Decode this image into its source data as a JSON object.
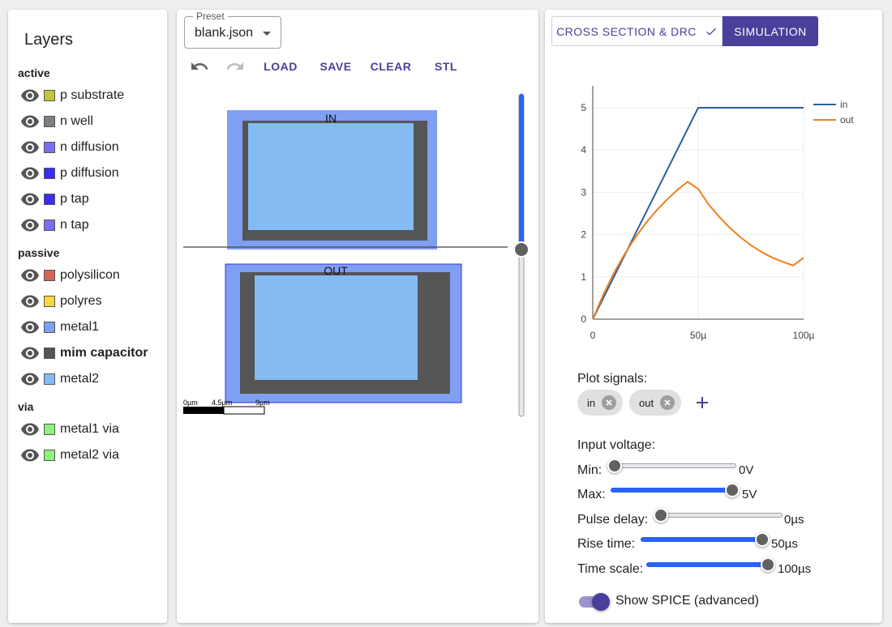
{
  "layers": {
    "title": "Layers",
    "groups": [
      {
        "name": "active",
        "items": [
          {
            "label": "p substrate",
            "color": "#c2c43a"
          },
          {
            "label": "n well",
            "color": "#7f7f7f"
          },
          {
            "label": "n diffusion",
            "color": "#7b6ef2"
          },
          {
            "label": "p diffusion",
            "color": "#3a2cf2"
          },
          {
            "label": "p tap",
            "color": "#3a2cf2"
          },
          {
            "label": "n tap",
            "color": "#7b6ef2"
          }
        ]
      },
      {
        "name": "passive",
        "items": [
          {
            "label": "polysilicon",
            "color": "#d86459"
          },
          {
            "label": "polyres",
            "color": "#f6d83c"
          },
          {
            "label": "metal1",
            "color": "#7f9ff2"
          },
          {
            "label": "mim capacitor",
            "color": "#555555",
            "bold": true
          },
          {
            "label": "metal2",
            "color": "#83bbf2"
          }
        ]
      },
      {
        "name": "via",
        "items": [
          {
            "label": "metal1 via",
            "color": "#8ef27b"
          },
          {
            "label": "metal2 via",
            "color": "#8ef27b"
          }
        ]
      }
    ]
  },
  "editor": {
    "preset_legend": "Preset",
    "preset_value": "blank.json",
    "toolbar": {
      "undo_icon": "undo-icon",
      "redo_icon": "redo-icon",
      "load": "LOAD",
      "save": "SAVE",
      "clear": "CLEAR",
      "stl": "STL"
    },
    "cross_section": {
      "top_label": "IN",
      "bottom_label": "OUT",
      "scale_labels": [
        "0µm",
        "4.5µm",
        "9µm"
      ],
      "colors": {
        "metal1": "#7f9ff2",
        "mim": "#555555",
        "metal2": "#83bbf2"
      }
    }
  },
  "sim": {
    "tabs": {
      "cross_section": "CROSS SECTION & DRC",
      "simulation": "SIMULATION"
    },
    "plot_signals_label": "Plot signals:",
    "signals": [
      "in",
      "out"
    ],
    "input_voltage_label": "Input voltage:",
    "sliders": [
      {
        "label": "Min:",
        "value": "0V",
        "fraction": 0.0
      },
      {
        "label": "Max:",
        "value": "5V",
        "fraction": 1.0
      },
      {
        "label": "Pulse delay:",
        "value": "0µs",
        "fraction": 0.0
      },
      {
        "label": "Rise time:",
        "value": "50µs",
        "fraction": 1.0
      },
      {
        "label": "Time scale:",
        "value": "100µs",
        "fraction": 1.0
      }
    ],
    "spice_toggle_label": "Show SPICE (advanced)",
    "spice_toggle_on": true
  },
  "chart_data": {
    "type": "line",
    "title": "",
    "xlabel": "",
    "ylabel": "",
    "x_tick_labels": [
      "0",
      "50µ",
      "100µ"
    ],
    "y_ticks": [
      0,
      1,
      2,
      3,
      4,
      5
    ],
    "xlim": [
      0,
      100
    ],
    "ylim": [
      0,
      5.25
    ],
    "legend_position": "top-right",
    "series": [
      {
        "name": "in",
        "color": "#2f5f9e",
        "x": [
          0,
          50,
          100
        ],
        "y": [
          0,
          5,
          5
        ]
      },
      {
        "name": "out",
        "color": "#f07f1c",
        "x": [
          0,
          5,
          10,
          15,
          20,
          25,
          30,
          35,
          40,
          45,
          50,
          55,
          60,
          65,
          70,
          75,
          80,
          85,
          90,
          95,
          100
        ],
        "y": [
          0,
          0.58,
          1.09,
          1.53,
          1.92,
          2.26,
          2.56,
          2.82,
          3.05,
          3.25,
          3.08,
          2.71,
          2.42,
          2.16,
          1.94,
          1.75,
          1.59,
          1.46,
          1.36,
          1.27,
          1.45
        ]
      }
    ]
  }
}
